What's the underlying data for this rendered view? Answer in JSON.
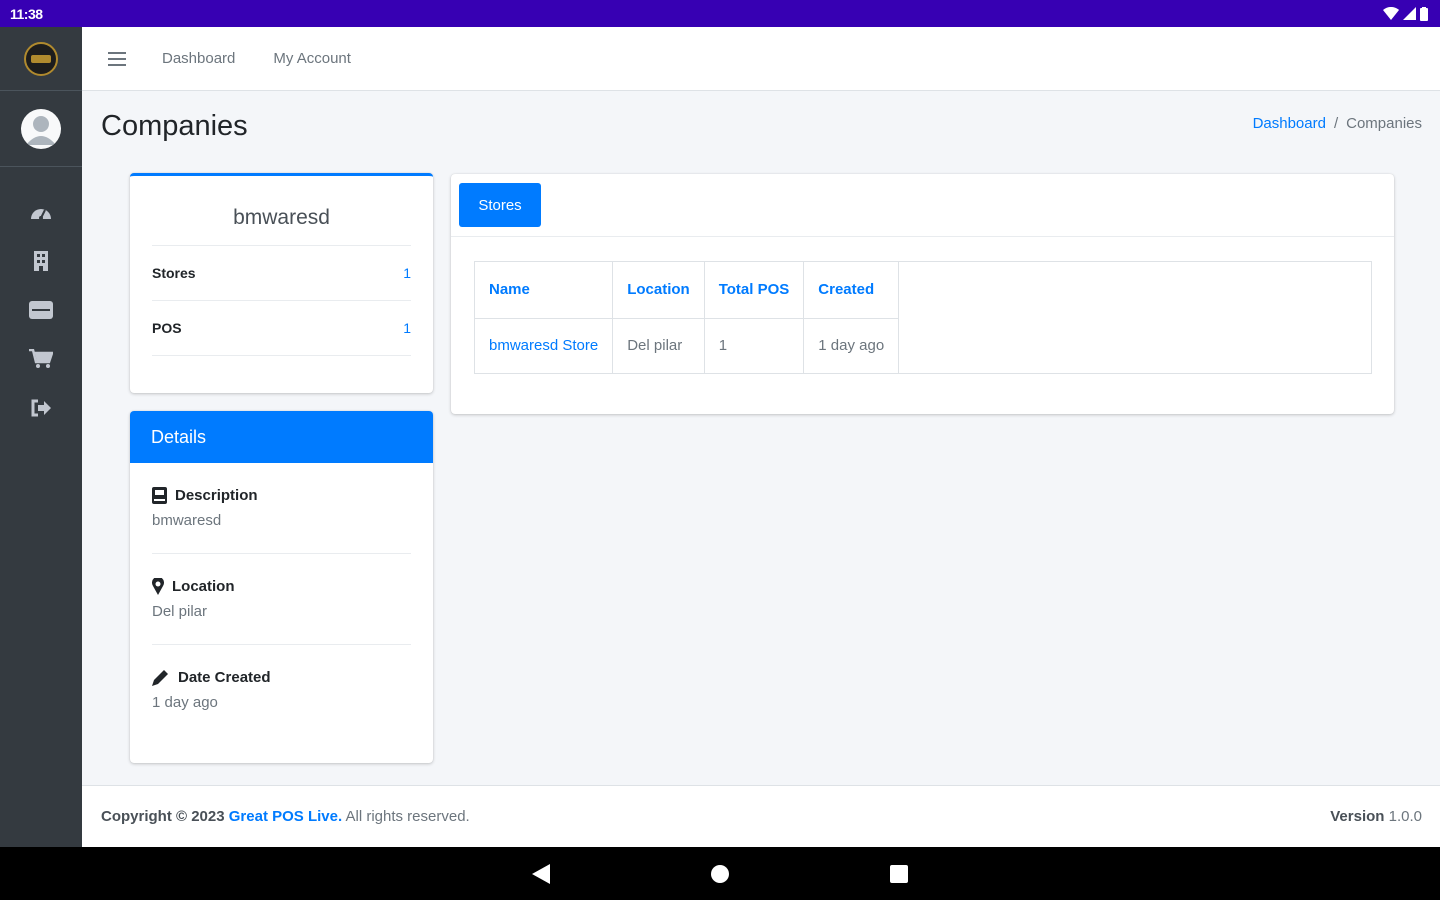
{
  "status_bar": {
    "time": "11:38"
  },
  "topnav": {
    "links": [
      "Dashboard",
      "My Account"
    ]
  },
  "page": {
    "title": "Companies",
    "breadcrumb": {
      "home": "Dashboard",
      "separator": "/",
      "current": "Companies"
    }
  },
  "profile": {
    "name": "bmwaresd",
    "stats": [
      {
        "label": "Stores",
        "value": "1"
      },
      {
        "label": "POS",
        "value": "1"
      }
    ]
  },
  "details": {
    "header": "Details",
    "items": [
      {
        "icon": "book-icon",
        "label": "Description",
        "value": "bmwaresd"
      },
      {
        "icon": "map-marker-icon",
        "label": "Location",
        "value": "Del pilar"
      },
      {
        "icon": "pencil-icon",
        "label": "Date Created",
        "value": "1 day ago"
      }
    ]
  },
  "stores": {
    "tab_label": "Stores",
    "columns": [
      "Name",
      "Location",
      "Total POS",
      "Created"
    ],
    "rows": [
      {
        "name": "bmwaresd Store",
        "location": "Del pilar",
        "total_pos": "1",
        "created": "1 day ago"
      }
    ]
  },
  "footer": {
    "copyright_prefix": "Copyright © 2023",
    "brand": "Great POS Live.",
    "suffix": "All rights reserved.",
    "version_label": "Version",
    "version": "1.0.0"
  },
  "colors": {
    "primary": "#007bff",
    "sidebar": "#343a40",
    "status_bar": "#3700b3"
  }
}
